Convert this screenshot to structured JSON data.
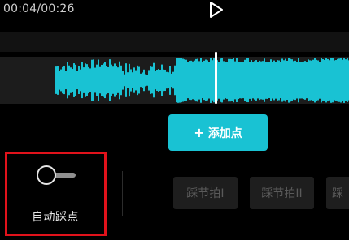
{
  "player": {
    "time": "00:04/00:26",
    "play_icon": "play-icon"
  },
  "timeline": {
    "waveform_color": "#19c2d3",
    "playhead_color": "#ffffff"
  },
  "actions": {
    "add_point_icon": "plus",
    "add_point_label": "添加点",
    "accent_color": "#19c2d3"
  },
  "auto_beat": {
    "label": "自动踩点",
    "toggle_on": false,
    "highlight_color": "#e1121b"
  },
  "beat_options": [
    {
      "label": "踩节拍I"
    },
    {
      "label": "踩节拍II"
    },
    {
      "label": "踩"
    }
  ]
}
